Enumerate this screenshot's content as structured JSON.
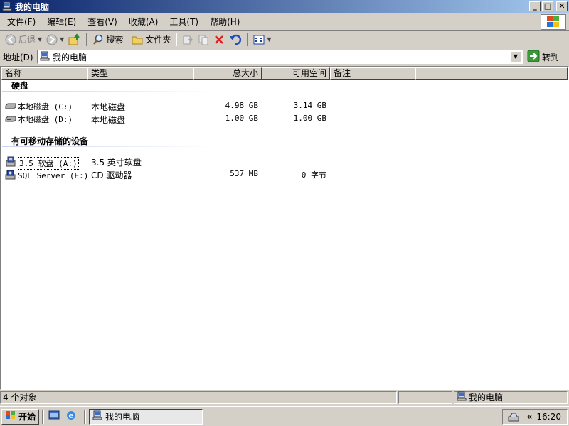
{
  "window": {
    "title": "我的电脑",
    "buttons": {
      "minimize": "_",
      "maximize": "□",
      "close": "✕"
    }
  },
  "menu": [
    "文件(F)",
    "编辑(E)",
    "查看(V)",
    "收藏(A)",
    "工具(T)",
    "帮助(H)"
  ],
  "toolbar": {
    "back_label": "后退",
    "search_label": "搜索",
    "folders_label": "文件夹"
  },
  "address": {
    "label": "地址(D)",
    "value": "我的电脑",
    "go_label": "转到"
  },
  "columns": [
    "名称",
    "类型",
    "总大小",
    "可用空间",
    "备注"
  ],
  "groups": [
    {
      "title": "硬盘",
      "items": [
        {
          "name": "本地磁盘 (C:)",
          "type": "本地磁盘",
          "total": "4.98 GB",
          "free": "3.14 GB",
          "icon": "hard-drive-icon"
        },
        {
          "name": "本地磁盘 (D:)",
          "type": "本地磁盘",
          "total": "1.00 GB",
          "free": "1.00 GB",
          "icon": "hard-drive-icon"
        }
      ]
    },
    {
      "title": "有可移动存储的设备",
      "items": [
        {
          "name": "3.5 软盘 (A:)",
          "type": "3.5 英寸软盘",
          "total": "",
          "free": "",
          "icon": "floppy-drive-icon"
        },
        {
          "name": "SQL Server (E:)",
          "type": "CD 驱动器",
          "total": "537 MB",
          "free": "0 字节",
          "icon": "cd-drive-icon"
        }
      ]
    }
  ],
  "status": {
    "count": "4 个对象",
    "location": "我的电脑"
  },
  "taskbar": {
    "start_label": "开始",
    "task_label": "我的电脑",
    "tray_expand": "«",
    "clock": "16:20"
  },
  "colors": {
    "title_start": "#0a246a",
    "title_end": "#a6caf0",
    "face": "#d4d0c8",
    "go_green": "#3a9a3a"
  }
}
